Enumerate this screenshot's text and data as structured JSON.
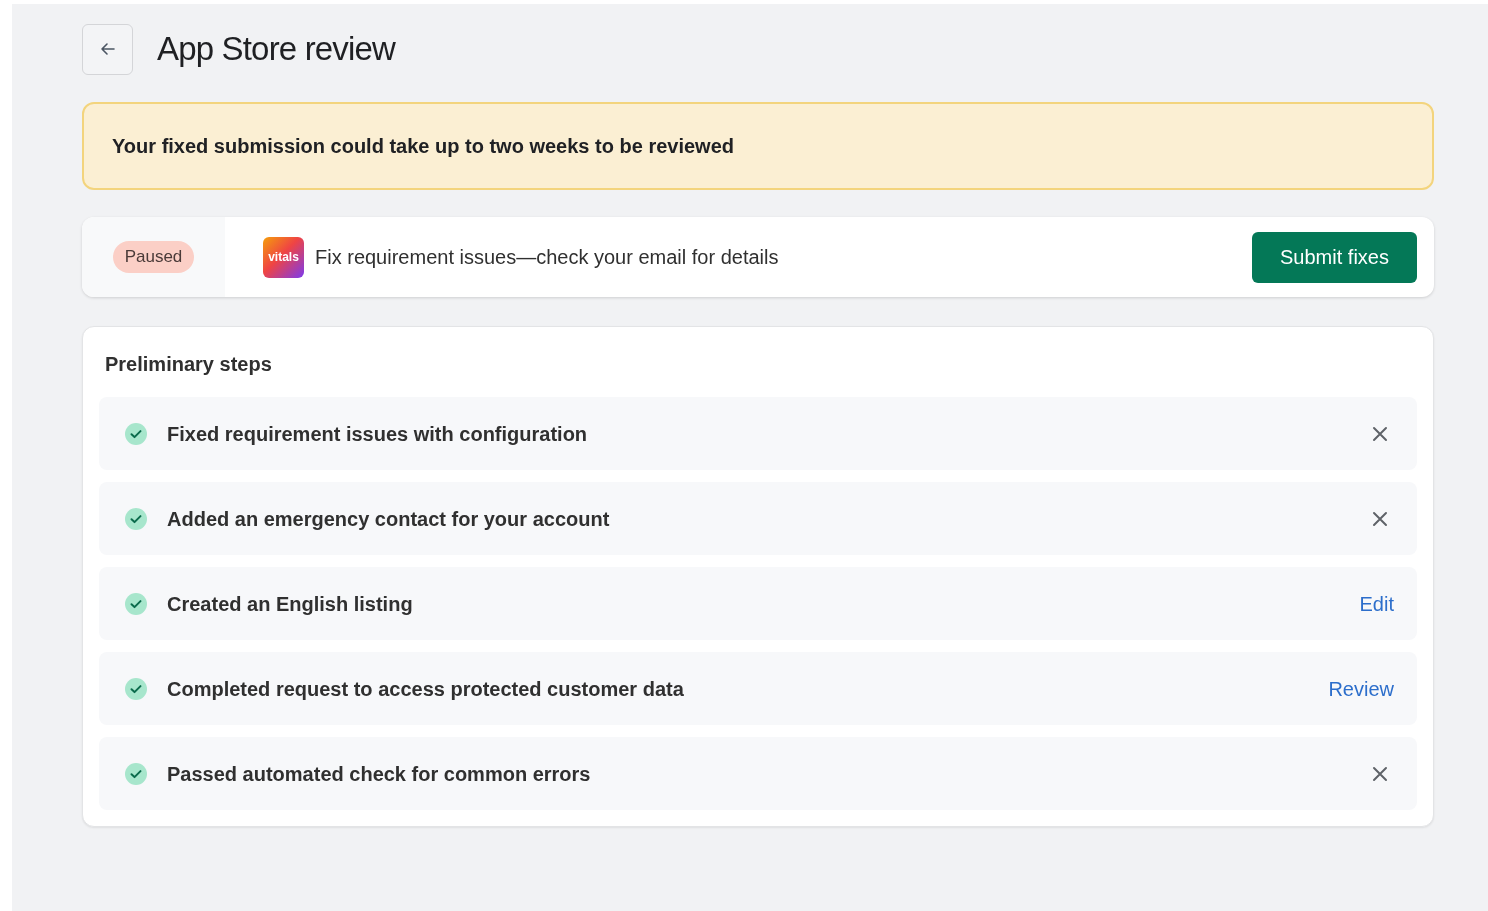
{
  "page": {
    "title": "App Store review"
  },
  "banner": {
    "text": "Your fixed submission could take up to two weeks to be reviewed"
  },
  "status": {
    "badge": "Paused",
    "logo_text": "vitals",
    "message": "Fix requirement issues—check your email for details",
    "button": "Submit fixes"
  },
  "steps": {
    "title": "Preliminary steps",
    "items": [
      {
        "label": "Fixed requirement issues with configuration",
        "completed": true,
        "kind": "dismiss"
      },
      {
        "label": "Added an emergency contact for your account",
        "completed": true,
        "kind": "dismiss"
      },
      {
        "label": "Created an English listing",
        "completed": true,
        "kind": "link",
        "action": "Edit"
      },
      {
        "label": "Completed request to access protected customer data",
        "completed": true,
        "kind": "link",
        "action": "Review"
      },
      {
        "label": "Passed automated check for common errors",
        "completed": true,
        "kind": "dismiss"
      }
    ]
  }
}
